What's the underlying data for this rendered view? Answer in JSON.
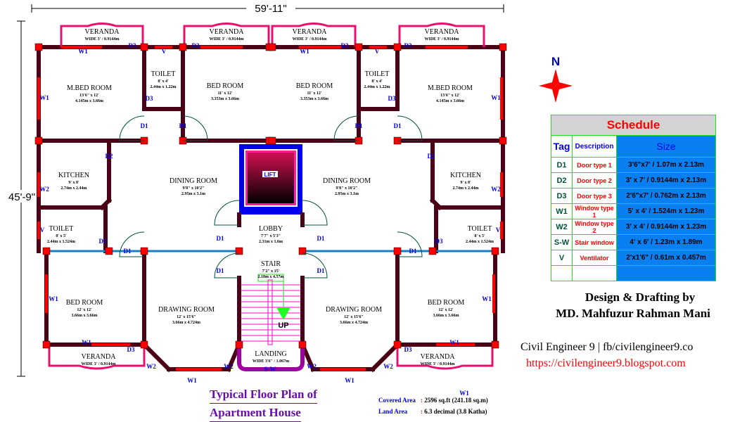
{
  "dimensions": {
    "width": "59'-11\"",
    "height": "45'-9\""
  },
  "rooms": [
    {
      "name": "VERANDA",
      "dim": "WIDE 3' / 0.9144m",
      "metric": ""
    },
    {
      "name": "VERANDA",
      "dim": "WIDE 3' / 0.9144m",
      "metric": ""
    },
    {
      "name": "VERANDA",
      "dim": "WIDE 3' / 0.9144m",
      "metric": ""
    },
    {
      "name": "VERANDA",
      "dim": "WIDE 3' / 0.9144m",
      "metric": ""
    },
    {
      "name": "M.BED ROOM",
      "dim": "13'6\" x 12'",
      "metric": "4.145m x 3.66m"
    },
    {
      "name": "TOILET",
      "dim": "8' x 4'",
      "metric": "2.44m x 1.22m"
    },
    {
      "name": "BED ROOM",
      "dim": "11' x 12'",
      "metric": "3.353m x 3.66m"
    },
    {
      "name": "BED ROOM",
      "dim": "11' x 12'",
      "metric": "3.353m x 3.66m"
    },
    {
      "name": "TOILET",
      "dim": "8' x 4'",
      "metric": "2.44m x 1.22m"
    },
    {
      "name": "M.BED ROOM",
      "dim": "13'6\" x 12'",
      "metric": "4.145m x 3.66m"
    },
    {
      "name": "KITCHEN",
      "dim": "9' x 8'",
      "metric": "2.74m x 2.44m"
    },
    {
      "name": "DINING ROOM",
      "dim": "9'8\" x 10'2\"",
      "metric": "2.95m x 3.1m"
    },
    {
      "name": "DINING ROOM",
      "dim": "9'8\" x 10'2\"",
      "metric": "2.95m x 3.1m"
    },
    {
      "name": "KITCHEN",
      "dim": "9' x 8'",
      "metric": "2.74m x 2.44m"
    },
    {
      "name": "TOILET",
      "dim": "8' x 5'",
      "metric": "2.44m x 1.524m"
    },
    {
      "name": "TOILET",
      "dim": "8' x 5'",
      "metric": "2.44m x 1.524m"
    },
    {
      "name": "LOBBY",
      "dim": "7'7\" x 5'3\"",
      "metric": "2.31m x 1.6m"
    },
    {
      "name": "STAIR",
      "dim": "7'2\" x 15'",
      "metric": "2.18m x 4.57m"
    },
    {
      "name": "BED ROOM",
      "dim": "12' x 12'",
      "metric": "3.66m x 3.66m"
    },
    {
      "name": "DRAWING ROOM",
      "dim": "12' x 15'6\"",
      "metric": "3.66m x 4.724m"
    },
    {
      "name": "DRAWING ROOM",
      "dim": "12' x 15'6\"",
      "metric": "3.66m x 4.724m"
    },
    {
      "name": "BED ROOM",
      "dim": "12' x 12'",
      "metric": "3.66m x 3.66m"
    },
    {
      "name": "LANDING",
      "dim": "WIDE 3'6\" / 1.067m",
      "metric": ""
    },
    {
      "name": "VERANDA",
      "dim": "WIDE 3' / 0.9144m",
      "metric": ""
    },
    {
      "name": "VERANDA",
      "dim": "WIDE 3' / 0.9144m",
      "metric": ""
    }
  ],
  "lift": {
    "label": "LIFT"
  },
  "stair_arrow": "UP",
  "tags": [
    "W1",
    "D3",
    "V",
    "D3",
    "W1",
    "D3",
    "V",
    "D3",
    "W1",
    "W1",
    "D3",
    "D3",
    "D1",
    "D1",
    "D1",
    "D1",
    "D2",
    "D2",
    "W2",
    "W2",
    "V",
    "V",
    "D3",
    "D3",
    "D1",
    "D1",
    "D1",
    "D1",
    "D1",
    "D1",
    "W1",
    "W1",
    "W1",
    "W1",
    "D3",
    "D3",
    "W2",
    "W2",
    "W2",
    "W2",
    "W1",
    "W1",
    "S-W",
    "W1"
  ],
  "compass": {
    "label": "N"
  },
  "schedule": {
    "title": "Schedule",
    "headers": [
      "Tag",
      "Description",
      "Size"
    ],
    "rows": [
      [
        "D1",
        "Door type 1",
        "3'6\"x7' / 1.07m x 2.13m"
      ],
      [
        "D2",
        "Door type 2",
        "3' x 7' / 0.9144m x 2.13m"
      ],
      [
        "D3",
        "Door type 3",
        "2'6\"x7' / 0.762m x 2.13m"
      ],
      [
        "W1",
        "Window type 1",
        "5' x 4' / 1.524m x 1.23m"
      ],
      [
        "W2",
        "Window type 2",
        "3' x 4' / 0.9144m x 1.23m"
      ],
      [
        "S-W",
        "Stair window",
        "4' x 6' / 1.23m x 1.89m"
      ],
      [
        "V",
        "Ventilator",
        "2'x1'6\" / 0.61m x 0.457m"
      ]
    ]
  },
  "credits": {
    "line1": "Design & Drafting by",
    "line2": "MD. Mahfuzur Rahman Mani",
    "line3": "Civil Engineer 9 | fb/civilengineer9.co",
    "line4": "https://civilengineer9.blogspot.com"
  },
  "title": {
    "line1": "Typical Floor Plan of",
    "line2": "Apartment House"
  },
  "areas": {
    "covered_label": "Covered Area",
    "covered_value": "2596 sq.ft (241.18 sq.m)",
    "land_label": "Land Area",
    "land_value": "6.3 decimal (3.8 Katha)"
  },
  "colors": {
    "wall": "#4a0015",
    "column": "#ff0000",
    "veranda": "#e8106e",
    "window": "#ff0000",
    "tag": "#0000ee",
    "stair": "#ff00cc",
    "schedule_size_bg": "#0a7ff0"
  }
}
